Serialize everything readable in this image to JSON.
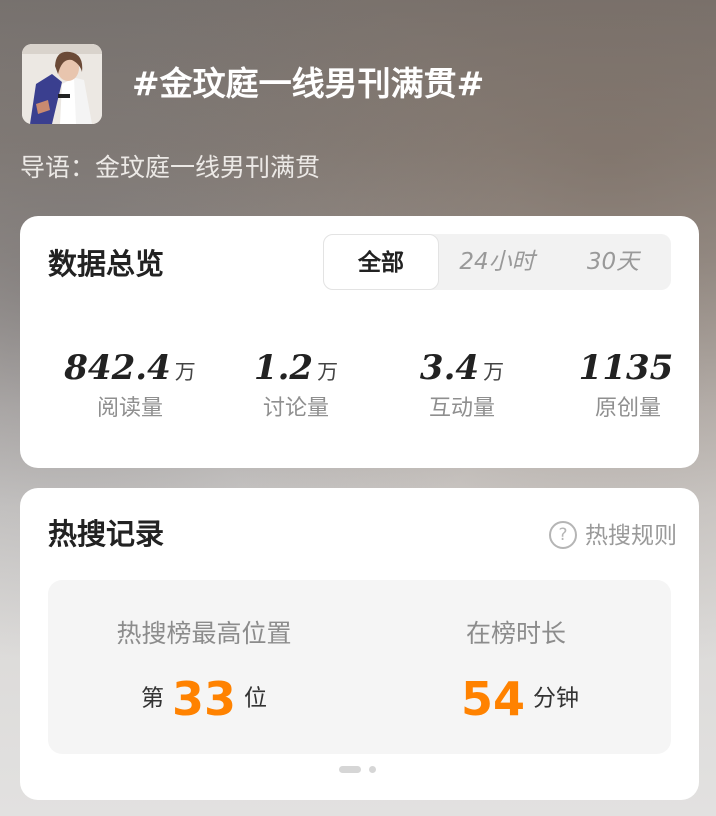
{
  "topic": {
    "title": "#金玟庭一线男刊满贯#",
    "guide": "导语：金玟庭一线男刊满贯",
    "avatar_icon": "topic-cover-photo"
  },
  "overview": {
    "title": "数据总览",
    "tabs": [
      {
        "label": "全部",
        "active": true
      },
      {
        "label": "24小时",
        "active": false
      },
      {
        "label": "30天",
        "active": false
      }
    ],
    "stats": [
      {
        "value": "842.4",
        "unit": "万",
        "label": "阅读量"
      },
      {
        "value": "1.2",
        "unit": "万",
        "label": "讨论量"
      },
      {
        "value": "3.4",
        "unit": "万",
        "label": "互动量"
      },
      {
        "value": "1135",
        "unit": "",
        "label": "原创量"
      }
    ]
  },
  "hot_search": {
    "title": "热搜记录",
    "rules_label": "热搜规则",
    "rules_icon": "question-circle-icon",
    "peak_label": "热搜榜最高位置",
    "peak_prefix": "第",
    "peak_value": "33",
    "peak_suffix": "位",
    "duration_label": "在榜时长",
    "duration_value": "54",
    "duration_unit": "分钟",
    "highlight_color": "#ff8200",
    "pager": {
      "pages": 2,
      "current": 1
    }
  }
}
